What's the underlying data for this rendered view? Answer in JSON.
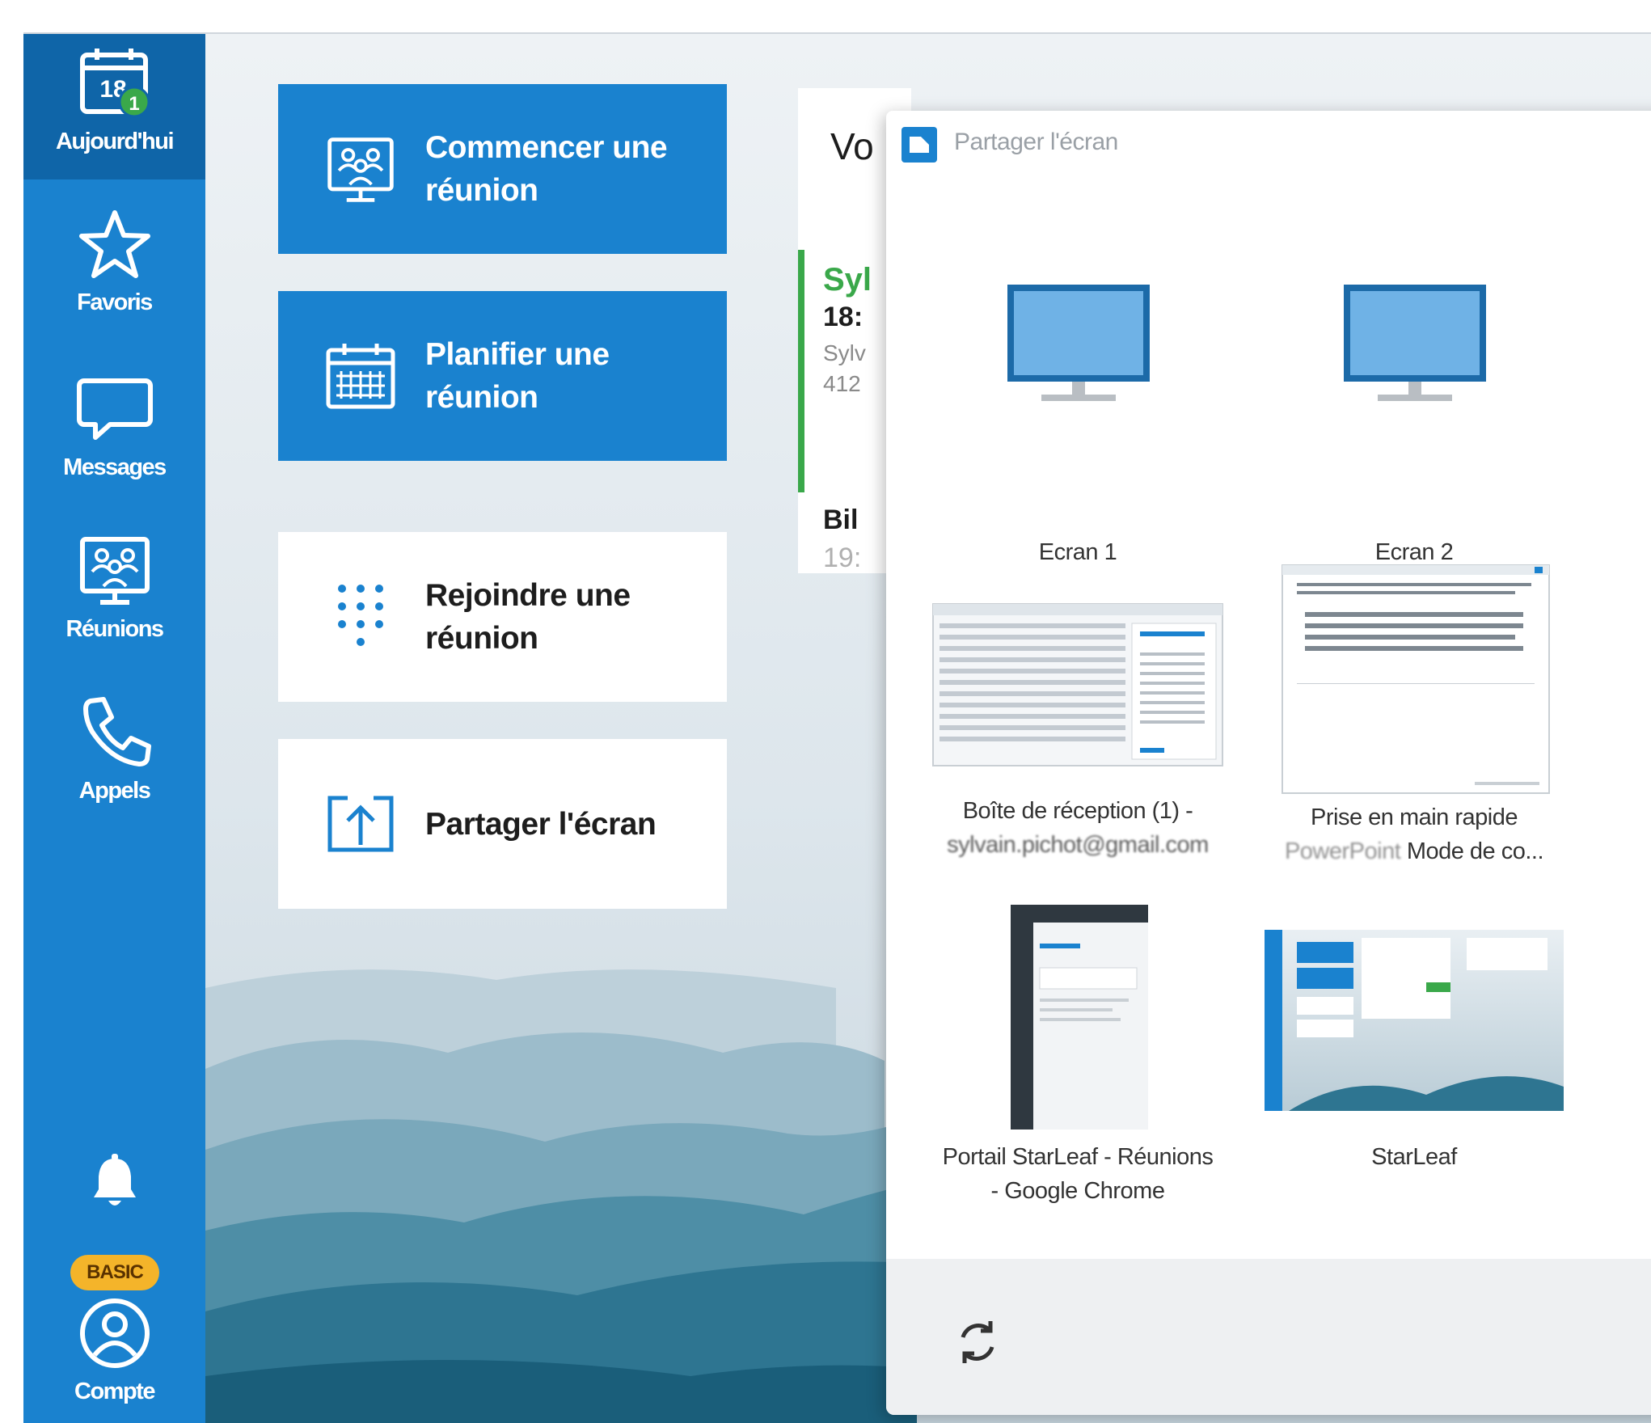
{
  "sidebar": {
    "today": {
      "label": "Aujourd'hui",
      "date": "18",
      "badge": "1",
      "icon": "calendar-icon"
    },
    "favorites": {
      "label": "Favoris",
      "icon": "star-icon"
    },
    "messages": {
      "label": "Messages",
      "icon": "chat-bubble-icon"
    },
    "meetings": {
      "label": "Réunions",
      "icon": "meeting-people-icon"
    },
    "calls": {
      "label": "Appels",
      "icon": "phone-icon"
    },
    "notifications": {
      "icon": "bell-icon"
    },
    "plan_badge": "BASIC",
    "account": {
      "label": "Compte",
      "icon": "user-circle-icon"
    }
  },
  "tiles": {
    "start": "Commencer une\nréunion",
    "plan": "Planifier une\nréunion",
    "join": "Rejoindre une\nréunion",
    "share": "Partager l'écran"
  },
  "meetings_card": {
    "title": "Vo",
    "item1": {
      "organizer": "Syl",
      "time": "18:",
      "line1": "Sylv",
      "line2": "412"
    },
    "item2": {
      "organizer": "Bil",
      "time": "19:"
    }
  },
  "share_dialog": {
    "title": "Partager l'écran",
    "sources": [
      {
        "type": "screen",
        "label": "Ecran 1"
      },
      {
        "type": "screen",
        "label": "Ecran 2"
      },
      {
        "type": "window",
        "label_line1": "Boîte de réception (1) -",
        "label_line2_obscured": "sylvain.pichot@gmail.com"
      },
      {
        "type": "window",
        "label_line1": "Prise en main rapide",
        "label_line2_prefix": "PowerPoint",
        "label_line2_suffix": "Mode de co..."
      },
      {
        "type": "window",
        "label_line1": "Portail StarLeaf - Réunions",
        "label_line2": "- Google Chrome"
      },
      {
        "type": "window",
        "label_line1": "StarLeaf"
      }
    ],
    "refresh_icon": "refresh-icon"
  },
  "colors": {
    "brand_blue": "#1a82cf",
    "selected_nav": "#0f65a8",
    "badge_green": "#3aa84a",
    "basic_badge": "#f4b42a"
  }
}
